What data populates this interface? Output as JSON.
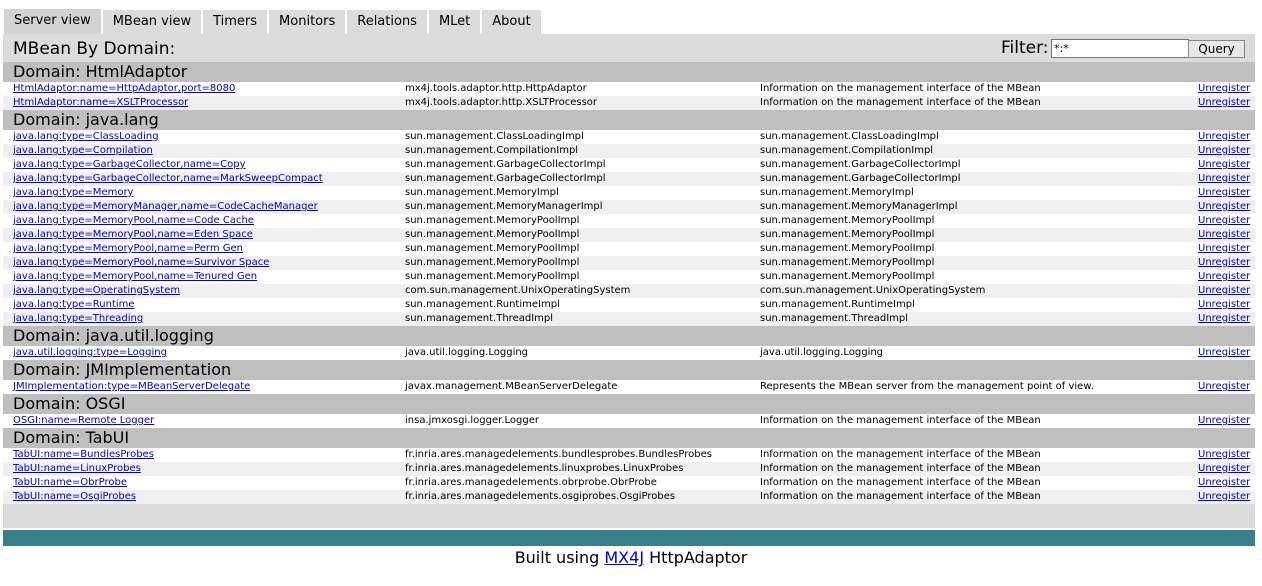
{
  "tabs": [
    {
      "label": "Server view",
      "active": true
    },
    {
      "label": "MBean view",
      "active": false
    },
    {
      "label": "Timers",
      "active": false
    },
    {
      "label": "Monitors",
      "active": false
    },
    {
      "label": "Relations",
      "active": false
    },
    {
      "label": "MLet",
      "active": false
    },
    {
      "label": "About",
      "active": false
    }
  ],
  "header": {
    "title": "MBean By Domain:",
    "filter_label": "Filter:",
    "filter_value": "*:*",
    "query_label": "Query"
  },
  "unregister_label": "Unregister",
  "domains": [
    {
      "title": "Domain: HtmlAdaptor",
      "rows": [
        [
          "HtmlAdaptor:name=HttpAdaptor,port=8080",
          "mx4j.tools.adaptor.http.HttpAdaptor",
          "Information on the management interface of the MBean"
        ],
        [
          "HtmlAdaptor:name=XSLTProcessor",
          "mx4j.tools.adaptor.http.XSLTProcessor",
          "Information on the management interface of the MBean"
        ]
      ]
    },
    {
      "title": "Domain: java.lang",
      "rows": [
        [
          "java.lang:type=ClassLoading",
          "sun.management.ClassLoadingImpl",
          "sun.management.ClassLoadingImpl"
        ],
        [
          "java.lang:type=Compilation",
          "sun.management.CompilationImpl",
          "sun.management.CompilationImpl"
        ],
        [
          "java.lang:type=GarbageCollector,name=Copy",
          "sun.management.GarbageCollectorImpl",
          "sun.management.GarbageCollectorImpl"
        ],
        [
          "java.lang:type=GarbageCollector,name=MarkSweepCompact",
          "sun.management.GarbageCollectorImpl",
          "sun.management.GarbageCollectorImpl"
        ],
        [
          "java.lang:type=Memory",
          "sun.management.MemoryImpl",
          "sun.management.MemoryImpl"
        ],
        [
          "java.lang:type=MemoryManager,name=CodeCacheManager",
          "sun.management.MemoryManagerImpl",
          "sun.management.MemoryManagerImpl"
        ],
        [
          "java.lang:type=MemoryPool,name=Code Cache",
          "sun.management.MemoryPoolImpl",
          "sun.management.MemoryPoolImpl"
        ],
        [
          "java.lang:type=MemoryPool,name=Eden Space",
          "sun.management.MemoryPoolImpl",
          "sun.management.MemoryPoolImpl"
        ],
        [
          "java.lang:type=MemoryPool,name=Perm Gen",
          "sun.management.MemoryPoolImpl",
          "sun.management.MemoryPoolImpl"
        ],
        [
          "java.lang:type=MemoryPool,name=Survivor Space",
          "sun.management.MemoryPoolImpl",
          "sun.management.MemoryPoolImpl"
        ],
        [
          "java.lang:type=MemoryPool,name=Tenured Gen",
          "sun.management.MemoryPoolImpl",
          "sun.management.MemoryPoolImpl"
        ],
        [
          "java.lang:type=OperatingSystem",
          "com.sun.management.UnixOperatingSystem",
          "com.sun.management.UnixOperatingSystem"
        ],
        [
          "java.lang:type=Runtime",
          "sun.management.RuntimeImpl",
          "sun.management.RuntimeImpl"
        ],
        [
          "java.lang:type=Threading",
          "sun.management.ThreadImpl",
          "sun.management.ThreadImpl"
        ]
      ]
    },
    {
      "title": "Domain: java.util.logging",
      "rows": [
        [
          "java.util.logging:type=Logging",
          "java.util.logging.Logging",
          "java.util.logging.Logging"
        ]
      ]
    },
    {
      "title": "Domain: JMImplementation",
      "rows": [
        [
          "JMImplementation:type=MBeanServerDelegate",
          "javax.management.MBeanServerDelegate",
          "Represents the MBean server from the management point of view."
        ]
      ]
    },
    {
      "title": "Domain: OSGI",
      "rows": [
        [
          "OSGI:name=Remote Logger",
          "insa.jmxosgi.logger.Logger",
          "Information on the management interface of the MBean"
        ]
      ]
    },
    {
      "title": "Domain: TabUI",
      "rows": [
        [
          "TabUI:name=BundlesProbes",
          "fr.inria.ares.managedelements.bundlesprobes.BundlesProbes",
          "Information on the management interface of the MBean"
        ],
        [
          "TabUI:name=LinuxProbes",
          "fr.inria.ares.managedelements.linuxprobes.LinuxProbes",
          "Information on the management interface of the MBean"
        ],
        [
          "TabUI:name=ObrProbe",
          "fr.inria.ares.managedelements.obrprobe.ObrProbe",
          "Information on the management interface of the MBean"
        ],
        [
          "TabUI:name=OsgiProbes",
          "fr.inria.ares.managedelements.osgiprobes.OsgiProbes",
          "Information on the management interface of the MBean"
        ]
      ]
    }
  ],
  "footer": {
    "prefix": "Built using",
    "link": "MX4J",
    "suffix": "HttpAdaptor"
  },
  "colors": {
    "panel": "#dcdcdc",
    "domain_header": "#bfbfbf",
    "link": "#0000cc",
    "footer_bar": "#3a7f8a"
  }
}
